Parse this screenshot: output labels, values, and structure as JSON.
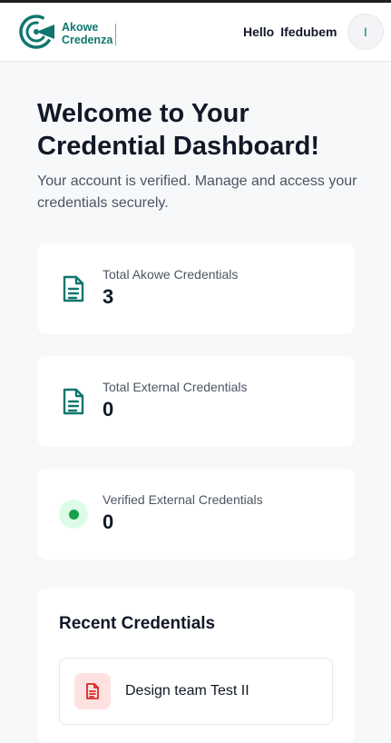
{
  "header": {
    "brand_line1": "Akowe",
    "brand_line2": "Credenza",
    "greeting": "Hello",
    "user_name": "Ifedubem",
    "avatar_initial": "I"
  },
  "main": {
    "title": "Welcome to Your Credential Dashboard!",
    "subtitle": "Your account is verified. Manage and access your credentials securely.",
    "stats": [
      {
        "label": "Total Akowe Credentials",
        "value": "3",
        "icon": "document-icon"
      },
      {
        "label": "Total External Credentials",
        "value": "0",
        "icon": "document-icon"
      },
      {
        "label": "Verified External Credentials",
        "value": "0",
        "icon": "status-dot-icon"
      }
    ],
    "recent": {
      "heading": "Recent Credentials",
      "items": [
        {
          "name": "Design team Test II",
          "icon": "file-icon"
        }
      ]
    }
  },
  "colors": {
    "brand": "#0f766e",
    "verified_dot": "#16a34a",
    "file_icon": "#dc2626"
  }
}
